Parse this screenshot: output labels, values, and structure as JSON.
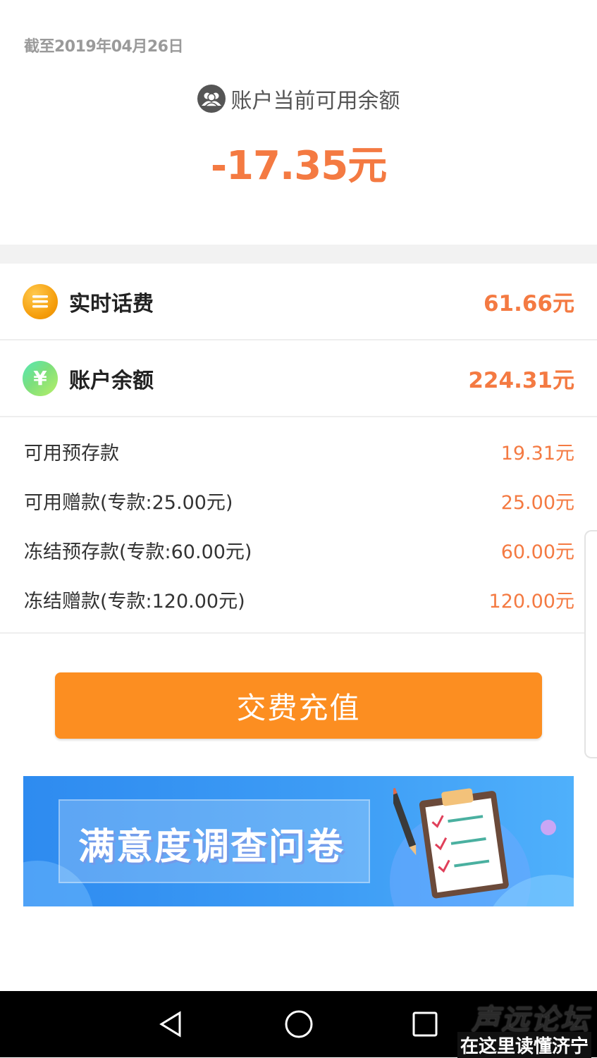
{
  "header": {
    "as_of_date": "截至2019年04月26日",
    "balance_label": "账户当前可用余额",
    "balance_amount": "-17.35元"
  },
  "summary_rows": [
    {
      "label": "实时话费",
      "value": "61.66元",
      "icon": "list-icon",
      "color": "#f59d0b"
    },
    {
      "label": "账户余额",
      "value": "224.31元",
      "icon": "yuan-icon",
      "icon_text": "¥",
      "color": "#7cdf7d"
    }
  ],
  "detail_rows": [
    {
      "label": "可用预存款",
      "value": "19.31元"
    },
    {
      "label": "可用赠款(专款:25.00元)",
      "value": "25.00元"
    },
    {
      "label": "冻结预存款(专款:60.00元)",
      "value": "60.00元"
    },
    {
      "label": "冻结赠款(专款:120.00元)",
      "value": "120.00元"
    }
  ],
  "actions": {
    "pay_button_label": "交费充值"
  },
  "banner": {
    "title": "满意度调查问卷"
  },
  "navbar": {
    "buttons": [
      "back-icon",
      "home-icon",
      "recents-icon"
    ]
  },
  "watermark": {
    "line1": "声远论坛",
    "line2": "在这里读懂济宁"
  },
  "colors": {
    "accent": "#f47a42",
    "button": "#fc8e21",
    "banner": "#3d9cf5"
  }
}
